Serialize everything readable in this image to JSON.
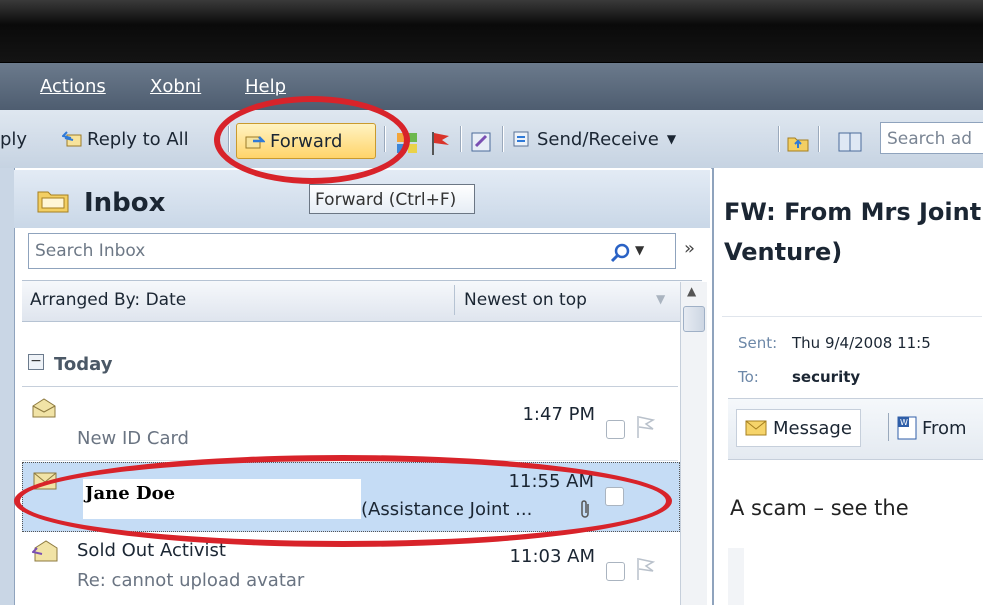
{
  "menu": {
    "items": [
      {
        "label": "Actions"
      },
      {
        "label": "Xobni"
      },
      {
        "label": "Help"
      }
    ]
  },
  "toolbar": {
    "reply_label": "ply",
    "reply_all_label": "Reply to All",
    "forward_label": "Forward",
    "send_receive_label": "Send/Receive",
    "search_placeholder": "Search ad"
  },
  "tooltip": {
    "text": "Forward (Ctrl+F)"
  },
  "inbox": {
    "title": "Inbox",
    "search_placeholder": "Search Inbox",
    "arranged_by": "Arranged By: Date",
    "sort_order": "Newest on top",
    "group_label": "Today",
    "messages": [
      {
        "sender": "",
        "subject": "New ID Card",
        "time": "1:47 PM"
      },
      {
        "sender": "Jane Doe",
        "subject": "Fw: From Mrs Melia Pereira (Assistance Joint ...",
        "time": "11:55 AM"
      },
      {
        "sender": "Sold Out Activist",
        "subject": "Re: cannot upload avatar",
        "time": "11:03 AM"
      }
    ]
  },
  "reading_pane": {
    "subject": "FW: From Mrs Joint Venture)",
    "sent_label": "Sent:",
    "sent_value": "Thu 9/4/2008 11:5",
    "to_label": "To:",
    "to_value": "security",
    "tab_message": "Message",
    "tab_attachment": "From",
    "body": "A scam – see the"
  },
  "colors": {
    "annotation_red": "#d8232a",
    "selected_row": "#c5dcf5",
    "forward_highlight": "#ffd46a"
  }
}
